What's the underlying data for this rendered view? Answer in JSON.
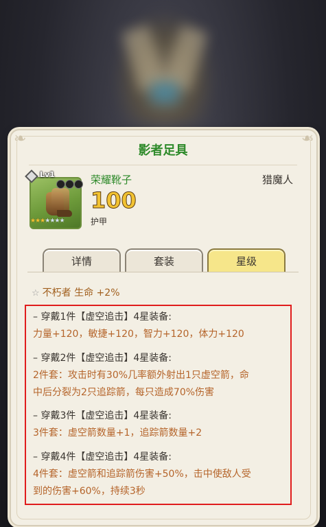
{
  "panel": {
    "title": "影者足具"
  },
  "item": {
    "level_badge": "Lv1",
    "name": "荣耀靴子",
    "class_label": "猎魔人",
    "value": "100",
    "type": "护甲",
    "stars_filled": 3,
    "stars_total": 7
  },
  "tabs": [
    {
      "label": "详情",
      "active": false
    },
    {
      "label": "套装",
      "active": false
    },
    {
      "label": "星级",
      "active": true
    }
  ],
  "star_bonus": "不朽者 生命 +2%",
  "sets": [
    {
      "head": "–  穿戴1件【虚空追击】4星装备:",
      "body": [
        "力量+120，敏捷+120，智力+120，体力+120"
      ]
    },
    {
      "head": "–  穿戴2件【虚空追击】4星装备:",
      "body": [
        "2件套：攻击时有30%几率额外射出1只虚空箭，命",
        "中后分裂为2只追踪箭，每只造成70%伤害"
      ]
    },
    {
      "head": "–  穿戴3件【虚空追击】4星装备:",
      "body": [
        "3件套：虚空箭数量+1，追踪箭数量+2"
      ]
    },
    {
      "head": "–  穿戴4件【虚空追击】4星装备:",
      "body": [
        "4件套：虚空箭和追踪箭伤害+50%，击中使敌人受",
        "到的伤害+60%，持续3秒"
      ]
    }
  ],
  "colors": {
    "title_green": "#2e8a2a",
    "value_gold": "#f1c232",
    "set_body": "#b5642a",
    "highlight_border": "#e01c1c",
    "active_tab": "#f6e68a"
  }
}
